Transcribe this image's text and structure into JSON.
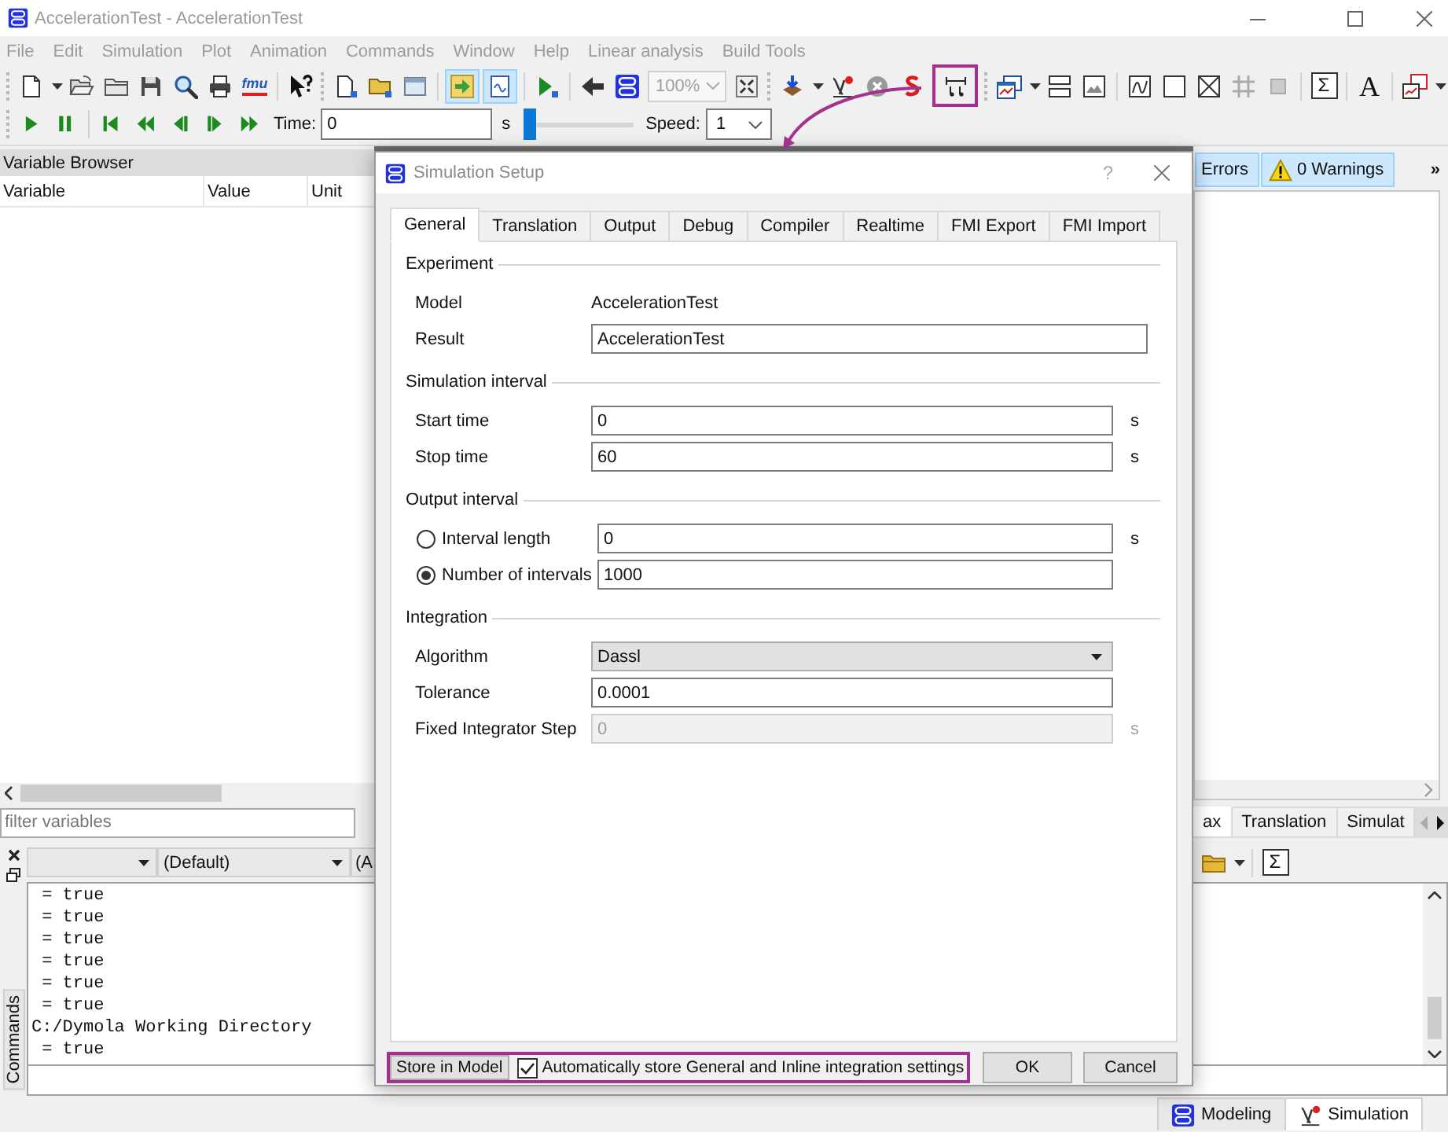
{
  "window": {
    "title": "AccelerationTest - AccelerationTest"
  },
  "menu_bar": [
    "File",
    "Edit",
    "Simulation",
    "Plot",
    "Animation",
    "Commands",
    "Window",
    "Help",
    "Linear analysis",
    "Build Tools"
  ],
  "toolbar": {
    "fmu_label": "fmu",
    "toggles": [
      {
        "on": true
      },
      {
        "on": true
      }
    ],
    "zoom": "100%",
    "sum_glyph": "Σ",
    "text_glyph": "A"
  },
  "playback": {
    "time_label": "Time:",
    "time_value": "0",
    "time_unit": "s",
    "slider": {
      "level": 0
    },
    "speed_label": "Speed:",
    "speed_value": "1"
  },
  "variable_browser": {
    "title": "Variable Browser",
    "columns": [
      "Variable",
      "Value",
      "Unit"
    ],
    "filter_placeholder": "filter variables"
  },
  "messages": {
    "filters": [
      {
        "kind": "error",
        "label": "Errors",
        "on": true
      },
      {
        "kind": "warning",
        "label": "0 Warnings",
        "on": true
      }
    ],
    "overflow_glyph": "»"
  },
  "output_tabs": [
    {
      "label": "ax",
      "selected": true
    },
    {
      "label": "Translation",
      "selected": false
    },
    {
      "label": "Simulat",
      "selected": false
    }
  ],
  "commands": {
    "side_tab": "Commands",
    "selectors": [
      "(Default)",
      "(A"
    ],
    "sum_glyph": "Σ",
    "log": [
      " = true",
      " = true",
      " = true",
      " = true",
      " = true",
      " = true",
      "C:/Dymola Working Directory",
      " = true"
    ]
  },
  "dialog": {
    "title": "Simulation Setup",
    "help_glyph": "?",
    "tabs": [
      {
        "label": "General",
        "selected": true
      },
      {
        "label": "Translation",
        "selected": false
      },
      {
        "label": "Output",
        "selected": false
      },
      {
        "label": "Debug",
        "selected": false
      },
      {
        "label": "Compiler",
        "selected": false
      },
      {
        "label": "Realtime",
        "selected": false
      },
      {
        "label": "FMI Export",
        "selected": false
      },
      {
        "label": "FMI Import",
        "selected": false
      }
    ],
    "groups": [
      {
        "title": "Experiment",
        "rows": [
          {
            "kind": "text",
            "label": "Model",
            "value": "AccelerationTest",
            "disabled": false
          },
          {
            "kind": "field",
            "label": "Result",
            "value": "AccelerationTest",
            "disabled": false
          }
        ]
      },
      {
        "title": "Simulation interval",
        "rows": [
          {
            "kind": "field",
            "label": "Start time",
            "value": "0",
            "unit": "s",
            "disabled": false
          },
          {
            "kind": "field",
            "label": "Stop time",
            "value": "60",
            "unit": "s",
            "disabled": false
          }
        ]
      },
      {
        "title": "Output interval",
        "rows": [
          {
            "kind": "radio",
            "label": "Interval length",
            "selected": false,
            "value": "0",
            "unit": "s",
            "disabled": false
          },
          {
            "kind": "radio",
            "label": "Number of intervals",
            "selected": true,
            "value": "1000",
            "disabled": false
          }
        ]
      },
      {
        "title": "Integration",
        "rows": [
          {
            "kind": "combo",
            "label": "Algorithm",
            "value": "Dassl",
            "disabled": false
          },
          {
            "kind": "field",
            "label": "Tolerance",
            "value": "0.0001",
            "disabled": false
          },
          {
            "kind": "field",
            "label": "Fixed Integrator Step",
            "value": "0",
            "unit": "s",
            "disabled": true
          }
        ]
      }
    ],
    "store_button": "Store in Model",
    "auto_store": {
      "label": "Automatically store General and Inline integration settings",
      "checked": true
    },
    "buttons": [
      "OK",
      "Cancel"
    ]
  },
  "mode_tabs": [
    {
      "label": "Modeling",
      "selected": false
    },
    {
      "label": "Simulation",
      "selected": true
    }
  ]
}
